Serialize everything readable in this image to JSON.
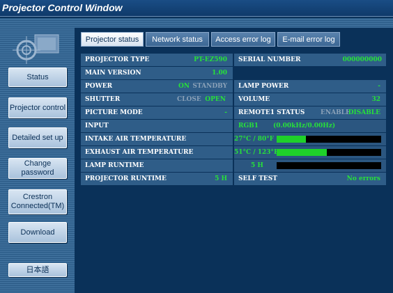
{
  "window": {
    "title": "Projector Control Window"
  },
  "sidebar": {
    "buttons": [
      {
        "label": "Status"
      },
      {
        "label": "Projector control"
      },
      {
        "label": "Detailed set up"
      },
      {
        "label": "Change password"
      },
      {
        "label": "Crestron Connected(TM)"
      },
      {
        "label": "Download"
      },
      {
        "label": "日本語"
      }
    ]
  },
  "tabs": [
    {
      "label": "Projector status"
    },
    {
      "label": "Network status"
    },
    {
      "label": "Access error log"
    },
    {
      "label": "E-mail error log"
    }
  ],
  "status": {
    "projector_type": {
      "label": "PROJECTOR TYPE",
      "value": "PT-EZ590"
    },
    "serial_number": {
      "label": "SERIAL NUMBER",
      "value": "000000000"
    },
    "main_version": {
      "label": "MAIN VERSION",
      "value": "1.00"
    },
    "power": {
      "label": "POWER",
      "on": "ON",
      "standby": "STANDBY"
    },
    "lamp_power": {
      "label": "LAMP POWER",
      "value": "-"
    },
    "shutter": {
      "label": "SHUTTER",
      "close": "CLOSE",
      "open": "OPEN"
    },
    "volume": {
      "label": "VOLUME",
      "value": "32"
    },
    "picture_mode": {
      "label": "PICTURE MODE",
      "value": "-"
    },
    "remote1_status": {
      "label": "REMOTE1 STATUS",
      "enable": "ENABLE",
      "disable": "DISABLE"
    },
    "input": {
      "label": "INPUT",
      "value": "RGB1",
      "freq": "(0.00kHz/0.00Hz)"
    },
    "intake_temp": {
      "label": "INTAKE AIR TEMPERATURE",
      "value": "27°C / 80°F",
      "level": 0.28
    },
    "exhaust_temp": {
      "label": "EXHAUST AIR TEMPERATURE",
      "value": "51°C / 123°F",
      "level": 0.48
    },
    "lamp_runtime": {
      "label": "LAMP RUNTIME",
      "value": "5 H",
      "level": 0.0
    },
    "projector_runtime": {
      "label": "PROJECTOR RUNTIME",
      "value": "5 H"
    },
    "self_test": {
      "label": "SELF TEST",
      "value": "No errors"
    }
  },
  "colors": {
    "accent_green": "#27e03a",
    "background": "#0a3159",
    "dim_text": "#8aa1b8"
  }
}
